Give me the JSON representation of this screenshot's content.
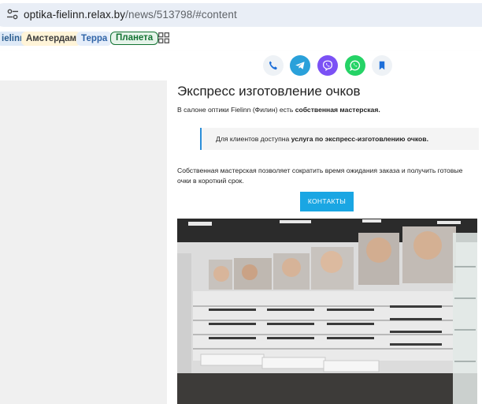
{
  "browser": {
    "address": {
      "domain": "optika-fielinn.relax.by",
      "path": "/news/513798/#content"
    },
    "bookmarks": [
      {
        "label": "ielinn"
      },
      {
        "label": "Амстердам"
      },
      {
        "label": "Терра"
      },
      {
        "label": "Планета"
      }
    ]
  },
  "share": {
    "items": [
      "phone-icon",
      "telegram-icon",
      "viber-icon",
      "whatsapp-icon",
      "bookmark-icon"
    ],
    "colors": {
      "telegram": "#2aa1da",
      "viber": "#7b51f5",
      "whatsapp": "#25d366",
      "neutral": "#eef2f6",
      "accent": "#1e6fd9"
    }
  },
  "article": {
    "title": "Экспресс изготовление очков",
    "intro_prefix": "В салоне оптики Fielinn (Филин) есть ",
    "intro_bold": "собственная мастерская.",
    "quote_prefix": "Для клиентов доступна ",
    "quote_bold": "услуга по экспресс-изготовлению очков.",
    "paragraph": "Собственная мастерская позволяет сократить время ожидания заказа и получить готовые очки в короткий срок.",
    "cta_label": "КОНТАКТЫ",
    "cta_color": "#1aa6e3"
  }
}
